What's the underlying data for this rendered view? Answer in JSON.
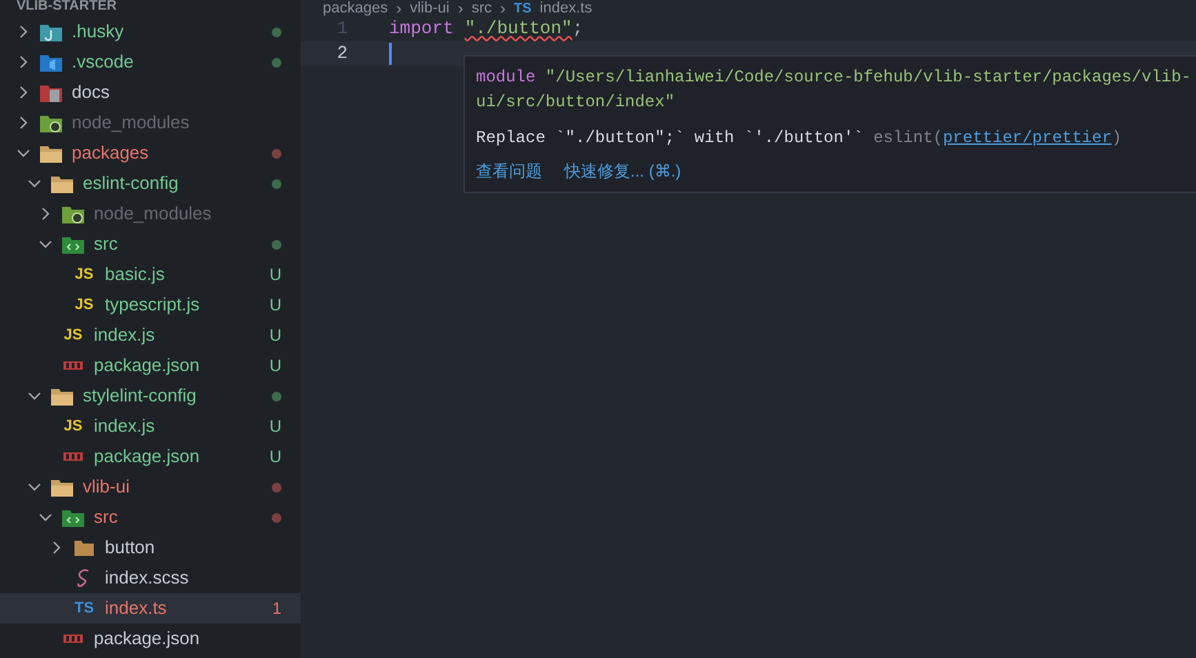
{
  "explorer": {
    "title": "VLIB-STARTER",
    "items": [
      {
        "label": ".husky",
        "kind": "folder-hook",
        "untracked": true,
        "error": false,
        "ignored": false,
        "expanded": false,
        "color": "#3d6b4c",
        "selected": false
      },
      {
        "label": ".vscode",
        "kind": "folder-vscode",
        "untracked": true,
        "error": false,
        "ignored": false,
        "expanded": false,
        "color": "#3d6b4c",
        "selected": false
      },
      {
        "label": "docs",
        "kind": "folder-docs",
        "untracked": false,
        "error": false,
        "ignored": false,
        "expanded": false,
        "selected": false
      },
      {
        "label": "node_modules",
        "kind": "folder-node",
        "untracked": false,
        "error": false,
        "ignored": true,
        "expanded": false,
        "selected": false
      },
      {
        "label": "packages",
        "kind": "folder",
        "untracked": false,
        "error": true,
        "ignored": false,
        "expanded": true,
        "color": "#7b4140",
        "selected": false,
        "children": [
          {
            "label": "eslint-config",
            "kind": "folder",
            "untracked": true,
            "error": false,
            "ignored": false,
            "expanded": true,
            "color": "#3d6b4c",
            "selected": false,
            "children": [
              {
                "label": "node_modules",
                "kind": "folder-node",
                "untracked": false,
                "error": false,
                "ignored": true,
                "expanded": false,
                "selected": false
              },
              {
                "label": "src",
                "kind": "folder-src",
                "untracked": true,
                "error": false,
                "ignored": false,
                "expanded": true,
                "color": "#3d6b4c",
                "selected": false,
                "children": [
                  {
                    "label": "basic.js",
                    "kind": "code",
                    "icon_text": "JS",
                    "untracked": true,
                    "error": false,
                    "ignored": false,
                    "badge": "U",
                    "selected": false
                  },
                  {
                    "label": "typescript.js",
                    "kind": "code",
                    "icon_text": "JS",
                    "untracked": true,
                    "error": false,
                    "ignored": false,
                    "badge": "U",
                    "selected": false
                  }
                ]
              },
              {
                "label": "index.js",
                "kind": "code",
                "icon_text": "JS",
                "untracked": true,
                "error": false,
                "ignored": false,
                "badge": "U",
                "selected": false
              },
              {
                "label": "package.json",
                "kind": "npm",
                "untracked": true,
                "error": false,
                "ignored": false,
                "badge": "U",
                "selected": false
              }
            ]
          },
          {
            "label": "stylelint-config",
            "kind": "folder",
            "untracked": true,
            "error": false,
            "ignored": false,
            "expanded": true,
            "color": "#3d6b4c",
            "selected": false,
            "children": [
              {
                "label": "index.js",
                "kind": "code",
                "icon_text": "JS",
                "untracked": true,
                "error": false,
                "ignored": false,
                "badge": "U",
                "selected": false
              },
              {
                "label": "package.json",
                "kind": "npm",
                "untracked": true,
                "error": false,
                "ignored": false,
                "badge": "U",
                "selected": false
              }
            ]
          },
          {
            "label": "vlib-ui",
            "kind": "folder",
            "untracked": false,
            "error": true,
            "ignored": false,
            "expanded": true,
            "color": "#7b4140",
            "selected": false,
            "children": [
              {
                "label": "src",
                "kind": "folder-src",
                "untracked": false,
                "error": true,
                "ignored": false,
                "expanded": true,
                "color": "#7b4140",
                "selected": false,
                "children": [
                  {
                    "label": "button",
                    "kind": "folder-plain",
                    "untracked": false,
                    "error": false,
                    "ignored": false,
                    "expanded": false,
                    "selected": false
                  },
                  {
                    "label": "index.scss",
                    "kind": "sass",
                    "untracked": false,
                    "error": false,
                    "ignored": false,
                    "selected": false
                  },
                  {
                    "label": "index.ts",
                    "kind": "code",
                    "icon_text": "TS",
                    "untracked": false,
                    "error": true,
                    "ignored": false,
                    "badge": "1",
                    "selected": true
                  }
                ]
              },
              {
                "label": "package.json",
                "kind": "npm",
                "untracked": false,
                "error": false,
                "ignored": false,
                "selected": false
              }
            ]
          }
        ]
      }
    ]
  },
  "editor": {
    "breadcrumb": [
      {
        "label": "packages"
      },
      {
        "separator": "›",
        "label": "vlib-ui"
      },
      {
        "separator": "›",
        "label": "src"
      },
      {
        "separator": "›",
        "icon_text": "TS",
        "label": "index.ts"
      }
    ],
    "lines": [
      {
        "number": "1",
        "keyword": "import",
        "string": "\"./button\"",
        "punct": ";",
        "active": false
      },
      {
        "number": "2",
        "active": true
      }
    ],
    "hover": {
      "module_keyword": "module",
      "module_path": "\"/Users/lianhaiwei/Code/source-bfehub/vlib-starter/packages/vlib-ui/src/button/index\"",
      "message": "Replace `\"./button\";` with `'./button'`",
      "source": "eslint(",
      "rule_link": "prettier/prettier",
      "source_end": ")",
      "actions": [
        "查看问题",
        "快速修复... (⌘.)"
      ]
    }
  }
}
